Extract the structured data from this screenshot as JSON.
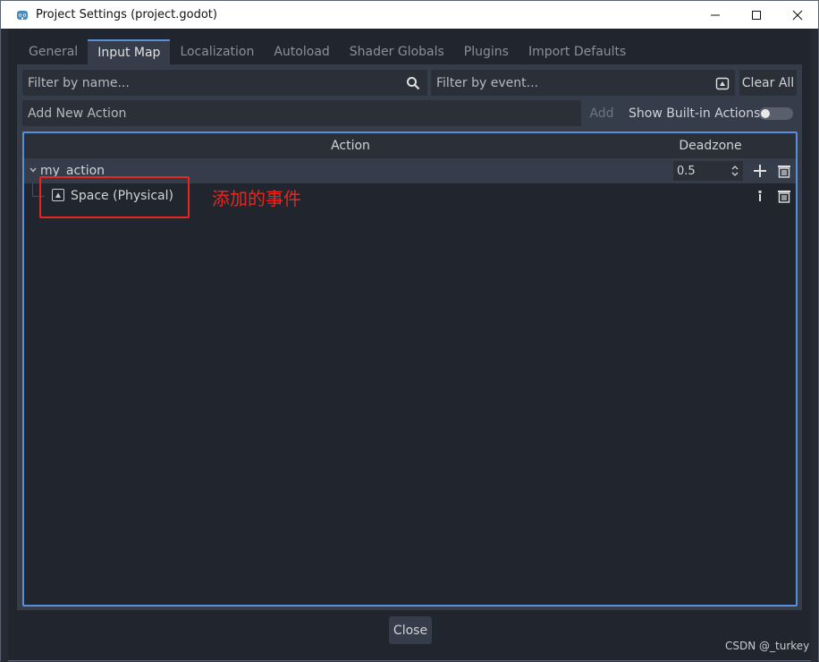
{
  "window": {
    "title": "Project Settings (project.godot)"
  },
  "tabs": [
    {
      "label": "General",
      "active": false
    },
    {
      "label": "Input Map",
      "active": true
    },
    {
      "label": "Localization",
      "active": false
    },
    {
      "label": "Autoload",
      "active": false
    },
    {
      "label": "Shader Globals",
      "active": false
    },
    {
      "label": "Plugins",
      "active": false
    },
    {
      "label": "Import Defaults",
      "active": false
    }
  ],
  "filters": {
    "name_placeholder": "Filter by name...",
    "event_placeholder": "Filter by event...",
    "clear_all_label": "Clear All"
  },
  "add_action": {
    "placeholder": "Add New Action",
    "add_label": "Add",
    "builtin_label": "Show Built-in Actions",
    "builtin_enabled": false
  },
  "tree": {
    "columns": [
      "Action",
      "Deadzone"
    ],
    "action": {
      "name": "my_action",
      "deadzone": "0.5"
    },
    "event": {
      "name": "Space (Physical)"
    }
  },
  "annotation": "添加的事件",
  "footer": {
    "close_label": "Close",
    "watermark": "CSDN @_turkey"
  },
  "colors": {
    "accent": "#5a8fd8",
    "annotation": "#e8261f",
    "panel": "#363d4a",
    "background": "#21262e"
  }
}
